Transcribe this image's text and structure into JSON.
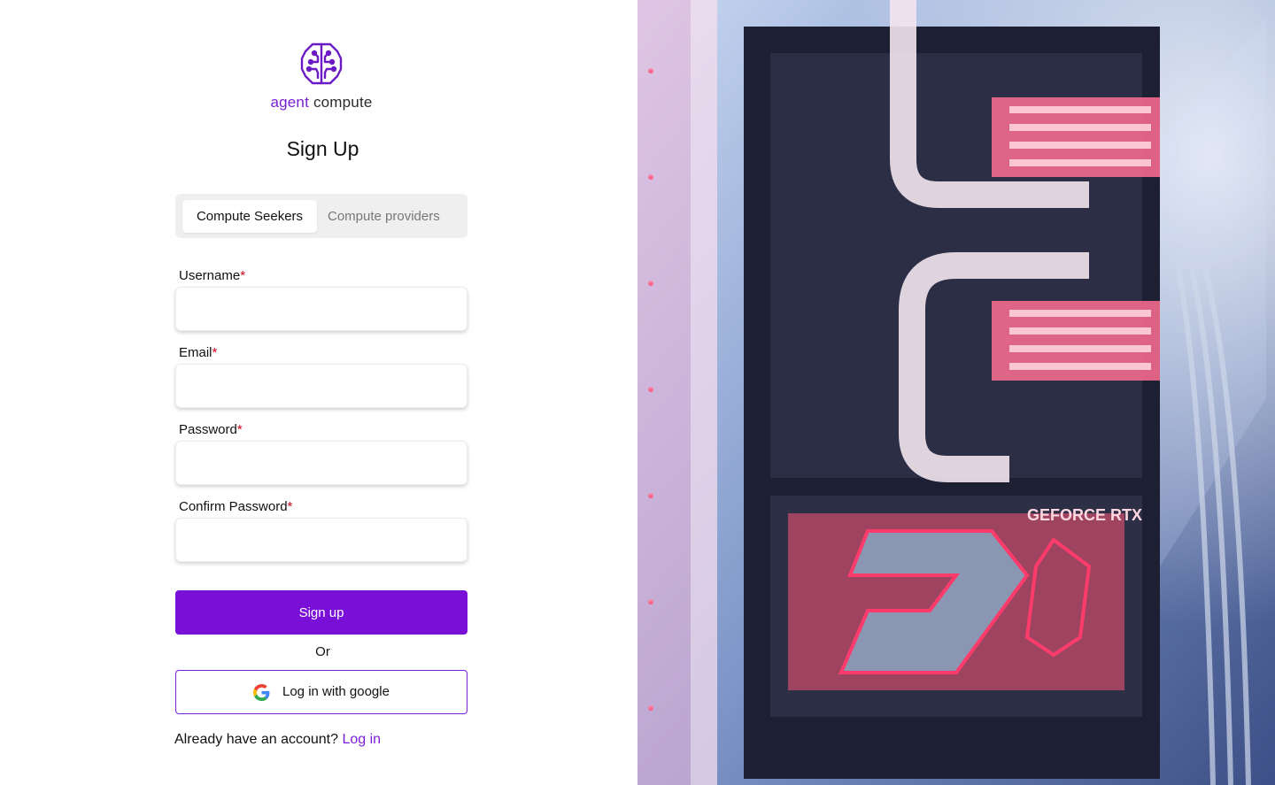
{
  "brand": {
    "name_part1": "agent",
    "name_part2": "compute",
    "logo_icon": "brain-circuit-icon",
    "accent_color": "#7a1fd6"
  },
  "page": {
    "title": "Sign Up"
  },
  "tabs": [
    {
      "label": "Compute Seekers",
      "active": true
    },
    {
      "label": "Compute providers",
      "active": false
    }
  ],
  "form": {
    "username": {
      "label": "Username",
      "required_mark": "*",
      "value": ""
    },
    "email": {
      "label": "Email",
      "required_mark": "*",
      "value": ""
    },
    "password": {
      "label": "Password",
      "required_mark": "*",
      "value": ""
    },
    "confirm_password": {
      "label": "Confirm Password",
      "required_mark": "*",
      "value": ""
    }
  },
  "actions": {
    "signup_label": "Sign up",
    "or_label": "Or",
    "google_label": "Log in with google",
    "google_icon": "google-g-icon",
    "already_text": "Already have an account?",
    "login_link": "Log in"
  },
  "hero_image": {
    "subject": "hero-image"
  }
}
